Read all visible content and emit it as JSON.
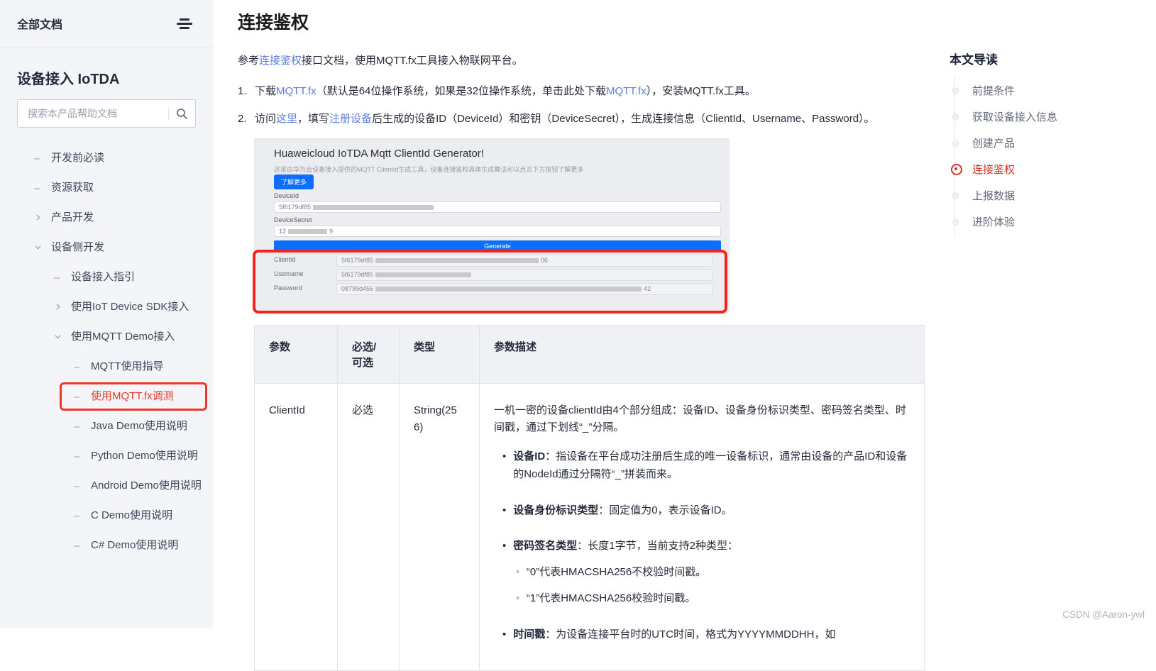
{
  "sidebar": {
    "header": {
      "title": "全部文档"
    },
    "product_title": "设备接入 IoTDA",
    "search": {
      "placeholder": "搜索本产品帮助文档",
      "icon": "search-icon"
    },
    "items": [
      {
        "label": "开发前必读",
        "cls": "lvl1 m-dash"
      },
      {
        "label": "资源获取",
        "cls": "lvl1 m-dash"
      },
      {
        "label": "产品开发",
        "cls": "lvl1 m-col"
      },
      {
        "label": "设备侧开发",
        "cls": "lvl1 m-exp"
      },
      {
        "label": "设备接入指引",
        "cls": "lvl2 m-dash"
      },
      {
        "label": "使用IoT Device SDK接入",
        "cls": "lvl2 m-col"
      },
      {
        "label": "使用MQTT Demo接入",
        "cls": "lvl2 m-exp"
      },
      {
        "label": "MQTT使用指导",
        "cls": "lvl3 m-dash"
      },
      {
        "label": "使用MQTT.fx调测",
        "cls": "lvl3 m-dash active annotated"
      },
      {
        "label": "Java Demo使用说明",
        "cls": "lvl3 m-dash"
      },
      {
        "label": "Python Demo使用说明",
        "cls": "lvl3 m-dash"
      },
      {
        "label": "Android Demo使用说明",
        "cls": "lvl3 m-dash"
      },
      {
        "label": "C Demo使用说明",
        "cls": "lvl3 m-dash"
      },
      {
        "label": "C# Demo使用说明",
        "cls": "lvl3 m-dash"
      }
    ]
  },
  "main": {
    "title": "连接鉴权",
    "intro": [
      {
        "text": "参考",
        "cls": "",
        "inter": "false"
      },
      {
        "text": "连接鉴权",
        "cls": "link",
        "inter": "true"
      },
      {
        "text": "接口文档，使用MQTT.fx工具接入物联网平台。",
        "cls": "",
        "inter": "false"
      }
    ],
    "steps": [
      {
        "num": "1.",
        "segments": [
          {
            "text": "下载",
            "cls": "",
            "inter": "false"
          },
          {
            "text": "MQTT.fx",
            "cls": "link",
            "inter": "true"
          },
          {
            "text": "（默认是64位操作系统，如果是32位操作系统，单击此处下载",
            "cls": "",
            "inter": "false"
          },
          {
            "text": "MQTT.fx",
            "cls": "link",
            "inter": "true"
          },
          {
            "text": "），安装MQTT.fx工具。",
            "cls": "",
            "inter": "false"
          }
        ]
      },
      {
        "num": "2.",
        "segments": [
          {
            "text": "访问",
            "cls": "",
            "inter": "false"
          },
          {
            "text": "这里",
            "cls": "link",
            "inter": "true"
          },
          {
            "text": "，填写",
            "cls": "",
            "inter": "false"
          },
          {
            "text": "注册设备",
            "cls": "link",
            "inter": "true"
          },
          {
            "text": "后生成的设备ID（DeviceId）和密钥（DeviceSecret），生成连接信息（ClientId、Username、Password）。",
            "cls": "",
            "inter": "false"
          }
        ]
      }
    ]
  },
  "screenshot": {
    "title": "Huaweicloud IoTDA Mqtt ClientId Generator!",
    "subtitle": "这是由华为云设备接入提供的MQTT ClientId生成工具，设备连接鉴权具体生成算法可以点击下方按钮了解更多",
    "learn_more_label": "了解更多",
    "deviceid_label": "DeviceId",
    "deviceid_value": "5f6179df85",
    "devicesecret_label": "DeviceSecret",
    "devicesecret_prefix": "12",
    "devicesecret_suffix": "9",
    "generate_label": "Generate",
    "results": [
      {
        "label": "ClientId",
        "prefix": "5f6179df85",
        "suffix": "06"
      },
      {
        "label": "Username",
        "prefix": "5f6179df85",
        "suffix": ""
      },
      {
        "label": "Password",
        "prefix": "08799d456",
        "suffix": "42"
      }
    ]
  },
  "table": {
    "headers": [
      "参数",
      "必选/可选",
      "类型",
      "参数描述"
    ],
    "row": {
      "param": "ClientId",
      "required": "必选",
      "type": "String(256)",
      "desc_intro": "一机一密的设备clientId由4个部分组成：设备ID、设备身份标识类型、密码签名类型、时间戳，通过下划线“_”分隔。",
      "bullets": [
        {
          "bold": "设备ID",
          "text": "：指设备在平台成功注册后生成的唯一设备标识，通常由设备的产品ID和设备的NodeId通过分隔符“_”拼装而来。"
        },
        {
          "bold": "设备身份标识类型",
          "text": "：固定值为0，表示设备ID。"
        },
        {
          "bold": "密码签名类型",
          "text": "：长度1字节，当前支持2种类型：",
          "sub": [
            "“0”代表HMACSHA256不校验时间戳。",
            "“1”代表HMACSHA256校验时间戳。"
          ]
        },
        {
          "bold": "时间戳",
          "text": "：为设备连接平台时的UTC时间，格式为YYYYMMDDHH，如"
        }
      ]
    }
  },
  "toc": {
    "title": "本文导读",
    "items": [
      {
        "label": "前提条件",
        "cls": ""
      },
      {
        "label": "获取设备接入信息",
        "cls": ""
      },
      {
        "label": "创建产品",
        "cls": ""
      },
      {
        "label": "连接鉴权",
        "cls": "active"
      },
      {
        "label": "上报数据",
        "cls": ""
      },
      {
        "label": "进阶体验",
        "cls": ""
      }
    ]
  },
  "watermark": "CSDN @Aaron-ywl"
}
